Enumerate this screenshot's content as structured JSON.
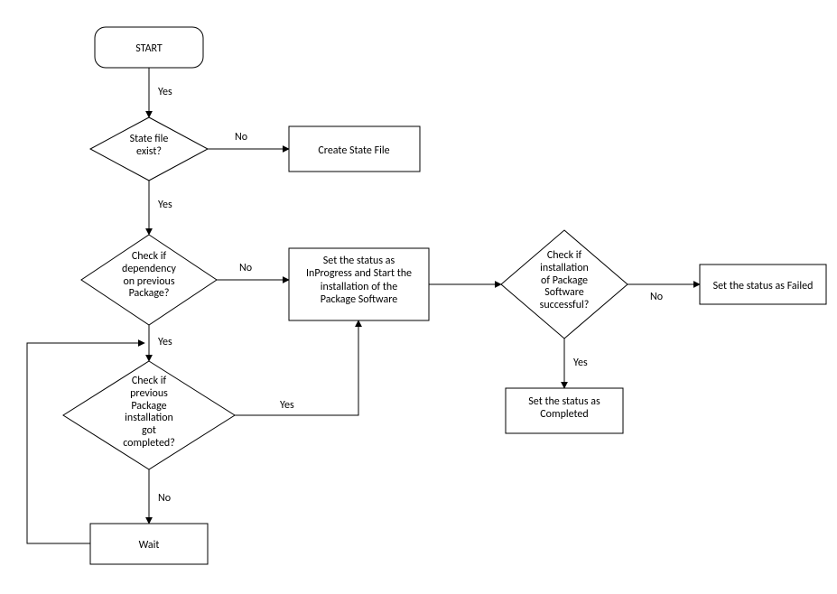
{
  "nodes": {
    "start": "START",
    "stateFileExist": "State file\nexist?",
    "createStateFile": "Create State File",
    "checkDependency": "Check if\ndependency\non previous\nPackage?",
    "setInProgress": "Set the status as\nInProgress and Start the\ninstallation of the\nPackage Software",
    "checkInstallSuccess": "Check if\ninstallation\nof Package\nSoftware\nsuccessful?",
    "setFailed": "Set the status as Failed",
    "checkPrevCompleted": "Check if\nprevious\nPackage\ninstallation\ngot\ncompleted?",
    "setCompleted": "Set the status as\nCompleted",
    "wait": "Wait"
  },
  "edges": {
    "yes": "Yes",
    "no": "No"
  }
}
